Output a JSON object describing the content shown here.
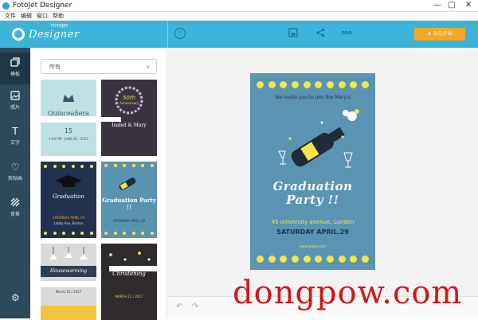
{
  "window": {
    "title": "FotoJet Designer",
    "minimize": "—",
    "maximize": "□",
    "close": "✕"
  },
  "menu": [
    "文件",
    "编辑",
    "窗口",
    "帮助"
  ],
  "header": {
    "logo_top": "FOTOJET",
    "logo": "Designer",
    "start_button": "现在开始"
  },
  "sidebar": {
    "items": [
      {
        "label": "模板",
        "icon": "template-icon"
      },
      {
        "label": "照片",
        "icon": "photo-icon"
      },
      {
        "label": "文字",
        "icon": "text-icon"
      },
      {
        "label": "剪贴画",
        "icon": "clipart-icon"
      },
      {
        "label": "背景",
        "icon": "background-icon"
      }
    ]
  },
  "panel": {
    "dropdown_value": "所有",
    "templates": [
      {
        "title": "Quinceañera",
        "small": "15",
        "subtitle": "1:00 PM · JUNE 26 · 2017"
      },
      {
        "title": "Isabel & Mary",
        "small": "50th",
        "subtitle": "Anniversary"
      },
      {
        "title": "Graduation",
        "small": "SATURDAY APRIL 29",
        "subtitle": "Lobby Ave, Boston"
      },
      {
        "title": "Graduation Party !!",
        "small": "SATURDAY APRIL.29",
        "subtitle": ""
      },
      {
        "title": "Housewarming",
        "small": "March 15 / 2017",
        "subtitle": ""
      },
      {
        "title": "Christening",
        "small": "MARCH 11 / 2017",
        "subtitle": ""
      }
    ]
  },
  "poster": {
    "invite": "We invite you to join the Mary's",
    "headline_1": "Graduation",
    "headline_2": "Party !!",
    "address": "45 university avenue, London",
    "date": "SATURDAY APRIL.29",
    "site": "www.fotojet.com"
  },
  "watermark": "dongpow.com",
  "colors": {
    "header": "#3cb4da",
    "sidebar": "#2c4a5b",
    "accent": "#f5a623",
    "poster": "#5b93b3",
    "dots": "#f3e646"
  }
}
